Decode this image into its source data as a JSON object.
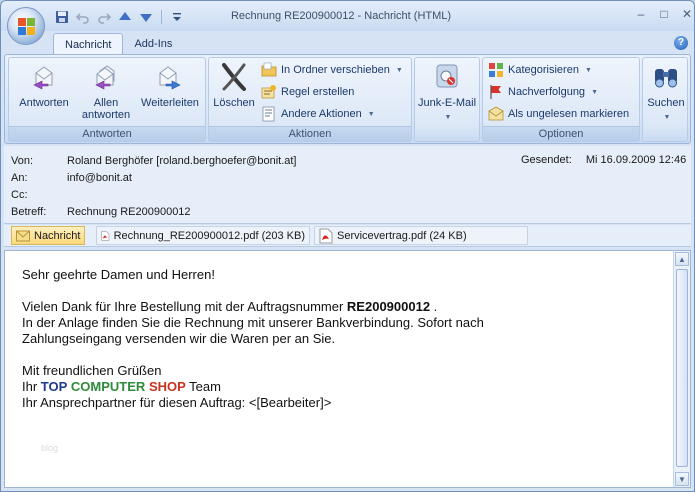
{
  "window": {
    "title": "Rechnung RE200900012 - Nachricht (HTML)"
  },
  "quick_access": [
    "save-icon",
    "undo-icon",
    "redo-icon",
    "previous-icon",
    "next-icon",
    "customize-icon"
  ],
  "window_controls": {
    "minimize": "–",
    "maximize": "□",
    "close": "✕"
  },
  "ribbon": {
    "tabs": [
      {
        "label": "Nachricht",
        "active": true
      },
      {
        "label": "Add-Ins",
        "active": false
      }
    ],
    "help": "?",
    "groups": {
      "antworten": {
        "label": "Antworten",
        "reply": "Antworten",
        "reply_all_1": "Allen",
        "reply_all_2": "antworten",
        "forward": "Weiterleiten"
      },
      "aktionen": {
        "label": "Aktionen",
        "delete": "Löschen",
        "move": "In Ordner verschieben",
        "rule": "Regel erstellen",
        "other": "Andere Aktionen"
      },
      "junk": {
        "label": "Junk-E-Mail"
      },
      "optionen": {
        "label": "Optionen",
        "categorize": "Kategorisieren",
        "followup": "Nachverfolgung",
        "unread": "Als ungelesen markieren"
      },
      "suchen": {
        "label": "Suchen"
      }
    }
  },
  "header": {
    "from_label": "Von:",
    "from_value": "Roland Berghöfer [roland.berghoefer@bonit.at]",
    "to_label": "An:",
    "to_value": "info@bonit.at",
    "cc_label": "Cc:",
    "cc_value": "",
    "subject_label": "Betreff:",
    "subject_value": "Rechnung RE200900012",
    "sent_label": "Gesendet:",
    "sent_value": "Mi 16.09.2009 12:46"
  },
  "attachments": {
    "message_label": "Nachricht",
    "files": [
      {
        "name": "Rechnung_RE200900012.pdf (203 KB)"
      },
      {
        "name": "Servicevertrag.pdf (24 KB)"
      }
    ]
  },
  "body": {
    "greeting": "Sehr geehrte Damen und Herren!",
    "line1_pre": "Vielen Dank für Ihre Bestellung mit der Auftragsnummer ",
    "order_no": "RE200900012",
    "line1_post": " .",
    "line2": "In der Anlage finden Sie die Rechnung mit unserer Bankverbindung. Sofort nach",
    "line3": "Zahlungseingang versenden wir die Waren per  an Sie.",
    "closing": "Mit freundlichen Grüßen",
    "team_pre": "Ihr ",
    "team_top": "TOP",
    "team_computer": "COMPUTER",
    "team_shop": "SHOP",
    "team_post": " Team",
    "contact": "Ihr Ansprechpartner für diesen Auftrag: <[Bearbeiter]>",
    "watermark": "blog"
  },
  "colors": {
    "top": "#1f3a8c",
    "computer": "#2e8b3a",
    "shop": "#c8321e"
  }
}
